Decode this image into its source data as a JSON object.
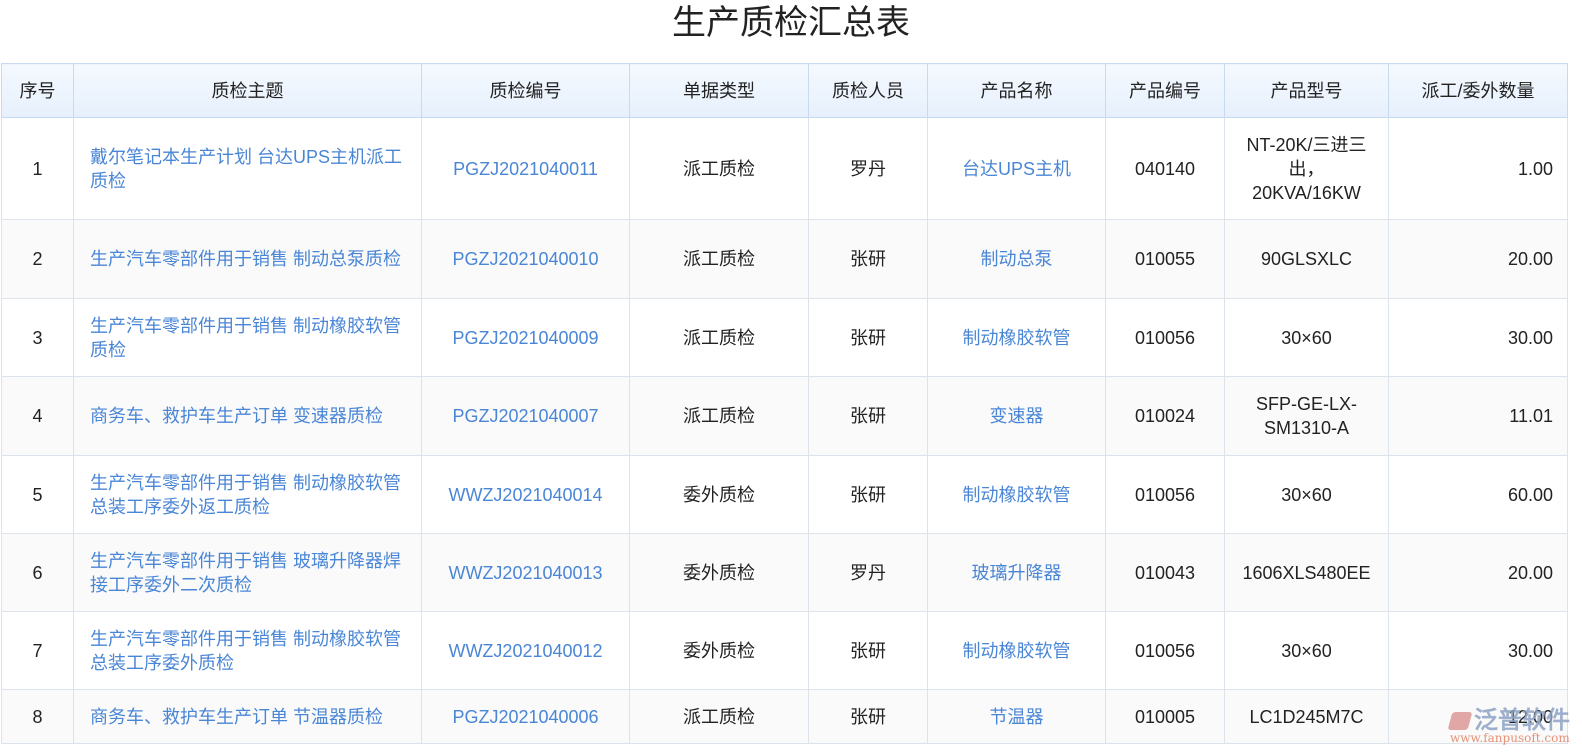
{
  "title": "生产质检汇总表",
  "headers": [
    "序号",
    "质检主题",
    "质检编号",
    "单据类型",
    "质检人员",
    "产品名称",
    "产品编号",
    "产品型号",
    "派工/委外数量"
  ],
  "rows": [
    [
      "1",
      "戴尔笔记本生产计划 台达UPS主机派工质检",
      "PGZJ2021040011",
      "派工质检",
      "罗丹",
      "台达UPS主机",
      "040140",
      "NT-20K/三进三出，20KVA/16KW",
      "1.00"
    ],
    [
      "2",
      "生产汽车零部件用于销售 制动总泵质检",
      "PGZJ2021040010",
      "派工质检",
      "张研",
      "制动总泵",
      "010055",
      "90GLSXLC",
      "20.00"
    ],
    [
      "3",
      "生产汽车零部件用于销售 制动橡胶软管质检",
      "PGZJ2021040009",
      "派工质检",
      "张研",
      "制动橡胶软管",
      "010056",
      "30×60",
      "30.00"
    ],
    [
      "4",
      "商务车、救护车生产订单 变速器质检",
      "PGZJ2021040007",
      "派工质检",
      "张研",
      "变速器",
      "010024",
      "SFP-GE-LX-SM1310-A",
      "11.01"
    ],
    [
      "5",
      "生产汽车零部件用于销售 制动橡胶软管总装工序委外返工质检",
      "WWZJ2021040014",
      "委外质检",
      "张研",
      "制动橡胶软管",
      "010056",
      "30×60",
      "60.00"
    ],
    [
      "6",
      "生产汽车零部件用于销售 玻璃升降器焊接工序委外二次质检",
      "WWZJ2021040013",
      "委外质检",
      "罗丹",
      "玻璃升降器",
      "010043",
      "1606XLS480EE",
      "20.00"
    ],
    [
      "7",
      "生产汽车零部件用于销售 制动橡胶软管总装工序委外质检",
      "WWZJ2021040012",
      "委外质检",
      "张研",
      "制动橡胶软管",
      "010056",
      "30×60",
      "30.00"
    ],
    [
      "8",
      "商务车、救护车生产订单 节温器质检",
      "PGZJ2021040006",
      "派工质检",
      "张研",
      "节温器",
      "010005",
      "LC1D245M7C",
      "12.00"
    ]
  ],
  "row_heights": [
    102,
    79,
    78,
    79,
    78,
    78,
    78,
    54
  ],
  "watermark": {
    "name": "泛普软件",
    "url": "www.fanpusoft.com"
  }
}
